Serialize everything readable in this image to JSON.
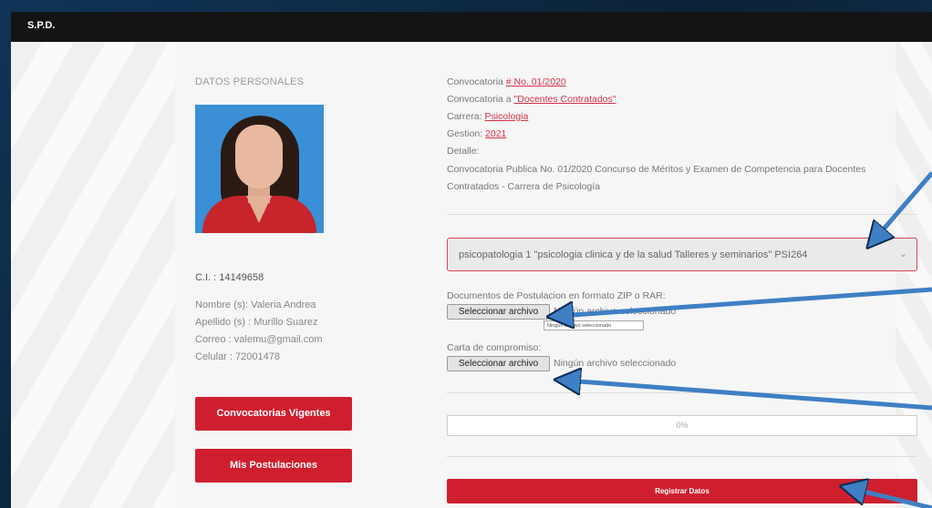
{
  "app": {
    "title": "S.P.D."
  },
  "profile": {
    "section_title": "DATOS PERSONALES",
    "ci": "C.I. : 14149658",
    "nombre": "Nombre (s): Valeria Andrea",
    "apellido": "Apellido (s) : Murillo Suarez",
    "correo": "Correo : valemu@gmail.com",
    "celular": "Celular : 72001478"
  },
  "buttons": {
    "convocatorias": "Convocatorias Vigentes",
    "postulaciones": "Mis Postulaciones",
    "registrar": "Registrar Datos"
  },
  "convocatoria": {
    "numero_prefix": "Convocatoria ",
    "numero_link": "# No. 01/2020",
    "tipo_prefix": "Convocatoria a ",
    "tipo_link": "\"Docentes Contratados\"",
    "carrera_prefix": "Carrera: ",
    "carrera_link": "Psicologia",
    "gestion_prefix": "Gestion: ",
    "gestion_link": "2021",
    "detalle_label": "Detalle:",
    "detalle_text": "Convocatoria Publica No. 01/2020 Concurso de Méritos y Examen de Competencia para Docentes Contratados - Carrera de Psicología"
  },
  "form": {
    "materia_selected": "psicopatologia 1 \"psicologia clinica y de la salud Talleres y seminarios\" PSI264",
    "documentos_label": "Documentos de Postulacion en formato ZIP o RAR:",
    "file_button": "Seleccionar archivo",
    "documentos_status": "Ningún archivo seleccionado",
    "tooltip": "Ningún archivo seleccionado",
    "carta_label": "Carta de compromiso:",
    "carta_status": "Ningún archivo seleccionado",
    "progress_text": "0%",
    "progress_value": 0
  },
  "colors": {
    "accent": "#cf1f2e",
    "link": "#d6334a",
    "arrow": "#3f7fc4"
  },
  "icons": {
    "select_arrow": "chevron-down-icon"
  }
}
